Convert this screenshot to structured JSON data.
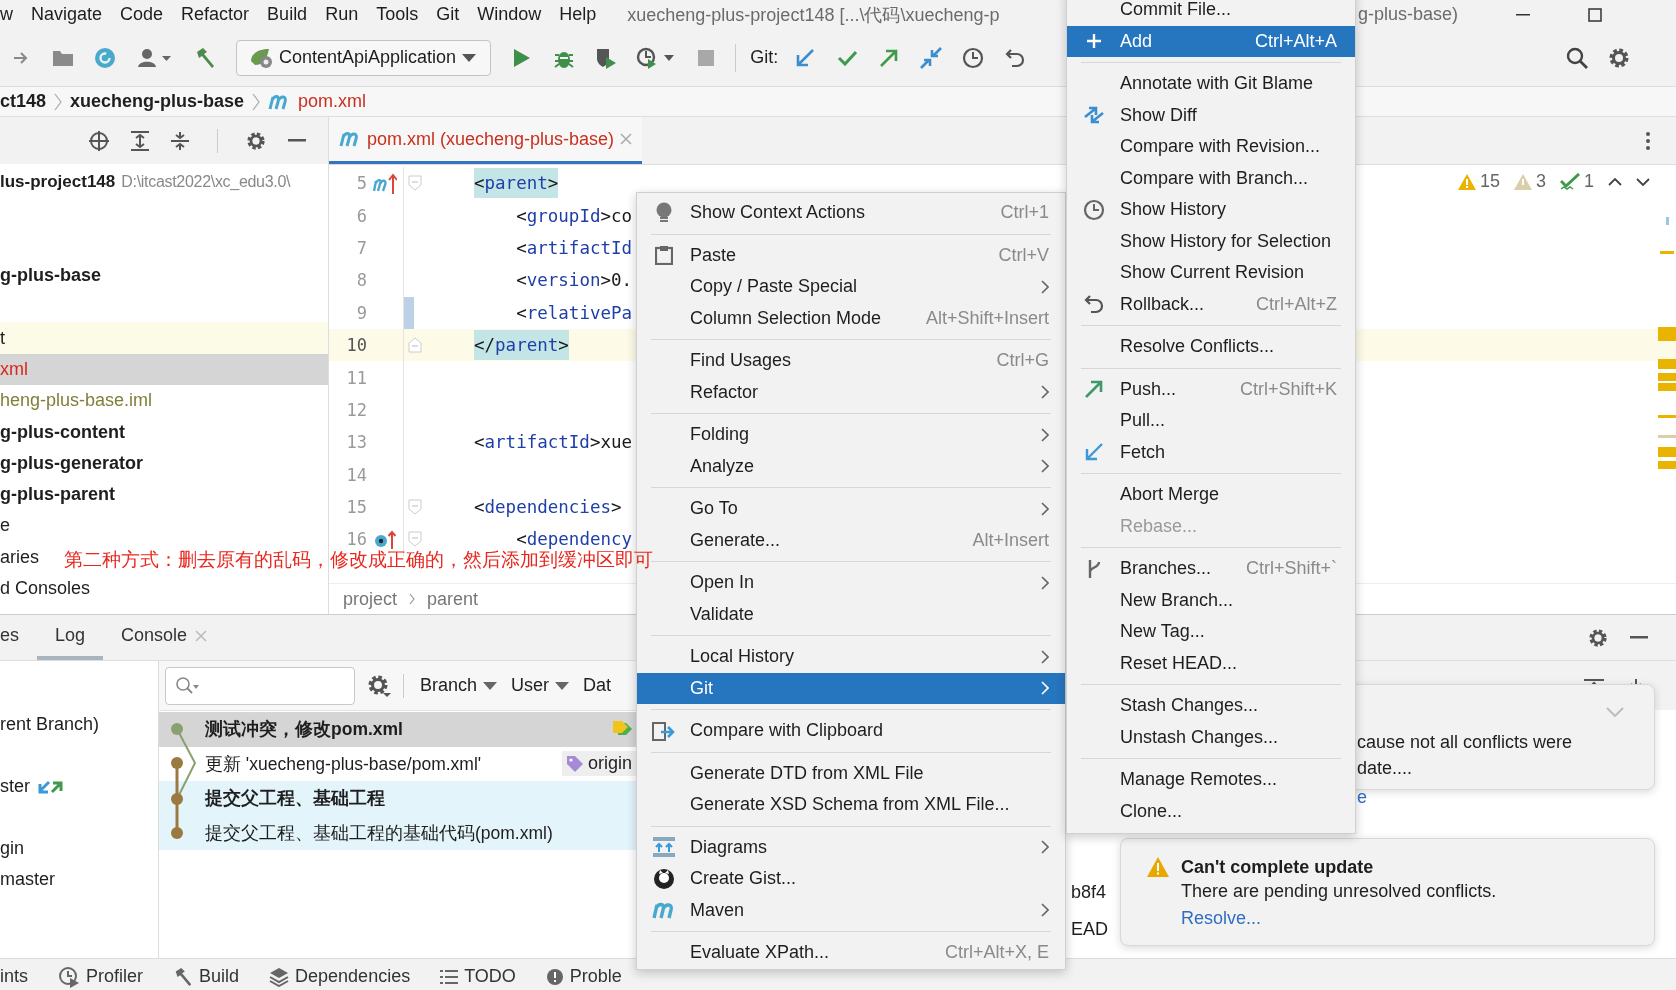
{
  "menu_bar": {
    "items": [
      "w",
      "Navigate",
      "Code",
      "Refactor",
      "Build",
      "Run",
      "Tools",
      "Git",
      "Window",
      "Help"
    ],
    "title": "xuecheng-plus-project148 [...\\代码\\xuecheng-p",
    "title_rest": "g-plus-base)"
  },
  "toolbar": {
    "run_config": "ContentApiApplication",
    "git_label": "Git:"
  },
  "breadcrumb": [
    {
      "text": "ct148",
      "kind": "folder"
    },
    {
      "text": "xuecheng-plus-base",
      "kind": "folder"
    },
    {
      "text": "pom.xml",
      "kind": "maven"
    }
  ],
  "project": {
    "root": {
      "name": "lus-project148",
      "path": "D:\\itcast2022\\xc_edu3.0\\"
    },
    "items": [
      {
        "kind": "blank",
        "selected": false,
        "highlighted": false
      },
      {
        "kind": "blank",
        "selected": false,
        "highlighted": false
      },
      {
        "text": "g-plus-base",
        "kind": "module",
        "selected": false,
        "highlighted": false,
        "color": "#1e1e1e"
      },
      {
        "kind": "blank",
        "selected": false,
        "highlighted": false
      },
      {
        "text": "t",
        "kind": "file",
        "selected": false,
        "highlighted": true,
        "color": "#1e1e1e"
      },
      {
        "text": "xml",
        "kind": "file",
        "selected": true,
        "highlighted": false,
        "color": "#d8281e"
      },
      {
        "text": "heng-plus-base.iml",
        "kind": "file",
        "selected": false,
        "highlighted": false,
        "color": "#7f7f3a"
      },
      {
        "text": "g-plus-content",
        "kind": "module",
        "selected": false,
        "highlighted": false,
        "color": "#1e1e1e"
      },
      {
        "text": "g-plus-generator",
        "kind": "module",
        "selected": false,
        "highlighted": false,
        "color": "#1e1e1e"
      },
      {
        "text": "g-plus-parent",
        "kind": "module",
        "selected": false,
        "highlighted": false,
        "color": "#1e1e1e"
      },
      {
        "text": "e",
        "kind": "file",
        "selected": false,
        "highlighted": false,
        "color": "#1e1e1e"
      },
      {
        "text": "aries",
        "kind": "file",
        "selected": false,
        "highlighted": false,
        "color": "#1e1e1e"
      },
      {
        "text": "d Consoles",
        "kind": "file",
        "selected": false,
        "highlighted": false,
        "color": "#1e1e1e"
      }
    ]
  },
  "editor": {
    "tab": {
      "label": "pom.xml (xuecheng-plus-base)",
      "selected": true
    },
    "lines": [
      {
        "number": "5",
        "code": "<parent>",
        "kind": "maven-marker",
        "matched": true,
        "current": false,
        "changed": false,
        "fold_start": true,
        "fold_end": false
      },
      {
        "number": "6",
        "code": "    <groupId>co",
        "kind": "plain",
        "matched": false,
        "current": false,
        "changed": false,
        "fold_start": false,
        "fold_end": false
      },
      {
        "number": "7",
        "code": "    <artifactId",
        "kind": "plain",
        "matched": false,
        "current": false,
        "changed": false,
        "fold_start": false,
        "fold_end": false
      },
      {
        "number": "8",
        "code": "    <version>0.",
        "kind": "plain",
        "matched": false,
        "current": false,
        "changed": false,
        "fold_start": false,
        "fold_end": false
      },
      {
        "number": "9",
        "code": "    <relativePa",
        "kind": "plain",
        "matched": false,
        "current": false,
        "changed": true,
        "fold_start": false,
        "fold_end": false
      },
      {
        "number": "10",
        "code": "</parent>",
        "kind": "plain",
        "matched": true,
        "current": true,
        "changed": false,
        "fold_start": false,
        "fold_end": true
      },
      {
        "number": "11",
        "kind": "plain",
        "current": false,
        "changed": false,
        "fold_start": false,
        "fold_end": false
      },
      {
        "number": "12",
        "kind": "plain",
        "current": false,
        "changed": false,
        "fold_start": false,
        "fold_end": false
      },
      {
        "number": "13",
        "code": "<artifactId>xue",
        "kind": "plain",
        "matched": false,
        "current": false,
        "changed": false,
        "fold_start": false,
        "fold_end": false
      },
      {
        "number": "14",
        "kind": "plain",
        "current": false,
        "changed": false,
        "fold_start": false,
        "fold_end": false
      },
      {
        "number": "15",
        "code": "<dependencies>",
        "kind": "plain",
        "matched": false,
        "current": false,
        "changed": false,
        "fold_start": true,
        "fold_end": false
      },
      {
        "number": "16",
        "code": "    <dependency",
        "kind": "dependency-marker",
        "matched": false,
        "current": false,
        "changed": false,
        "fold_start": true,
        "fold_end": false
      }
    ],
    "inspections": {
      "warnings": "15",
      "weak_warnings": "3",
      "typos": "1"
    },
    "breadcrumb": [
      "project",
      "parent"
    ]
  },
  "context_menu": {
    "sections": [
      {
        "items": [
          {
            "label": "Show Context Actions",
            "shortcut": "Ctrl+1",
            "submenu": false,
            "selected": false
          }
        ]
      },
      {
        "items": [
          {
            "label": "Paste",
            "shortcut": "Ctrl+V",
            "submenu": false,
            "selected": false
          },
          {
            "label": "Copy / Paste Special",
            "submenu": true,
            "selected": false
          },
          {
            "label": "Column Selection Mode",
            "shortcut": "Alt+Shift+Insert",
            "submenu": false,
            "selected": false
          }
        ]
      },
      {
        "items": [
          {
            "label": "Find Usages",
            "shortcut": "Ctrl+G",
            "submenu": false,
            "selected": false
          },
          {
            "label": "Refactor",
            "submenu": true,
            "selected": false
          }
        ]
      },
      {
        "items": [
          {
            "label": "Folding",
            "submenu": true,
            "selected": false
          },
          {
            "label": "Analyze",
            "submenu": true,
            "selected": false
          }
        ]
      },
      {
        "items": [
          {
            "label": "Go To",
            "submenu": true,
            "selected": false
          },
          {
            "label": "Generate...",
            "shortcut": "Alt+Insert",
            "submenu": false,
            "selected": false
          }
        ]
      },
      {
        "items": [
          {
            "label": "Open In",
            "submenu": true,
            "selected": false
          },
          {
            "label": "Validate",
            "submenu": false,
            "selected": false
          }
        ]
      },
      {
        "items": [
          {
            "label": "Local History",
            "submenu": true,
            "selected": false
          },
          {
            "label": "Git",
            "submenu": true,
            "selected": true
          }
        ]
      },
      {
        "items": [
          {
            "label": "Compare with Clipboard",
            "submenu": false,
            "selected": false
          }
        ]
      },
      {
        "items": [
          {
            "label": "Generate DTD from XML File",
            "submenu": false,
            "selected": false
          },
          {
            "label": "Generate XSD Schema from XML File...",
            "submenu": false,
            "selected": false
          }
        ]
      },
      {
        "items": [
          {
            "label": "Diagrams",
            "submenu": true,
            "selected": false
          },
          {
            "label": "Create Gist...",
            "submenu": false,
            "selected": false
          },
          {
            "label": "Maven",
            "submenu": true,
            "selected": false
          }
        ]
      },
      {
        "items": [
          {
            "label": "Evaluate XPath...",
            "shortcut": "Ctrl+Alt+X, E",
            "submenu": false,
            "selected": false
          }
        ]
      }
    ]
  },
  "git_menu": {
    "sections": [
      {
        "items": [
          {
            "label": "Commit File...",
            "selected": false,
            "disabled": false
          },
          {
            "label": "Add",
            "shortcut": "Ctrl+Alt+A",
            "selected": true,
            "disabled": false
          }
        ]
      },
      {
        "items": [
          {
            "label": "Annotate with Git Blame",
            "selected": false,
            "disabled": false
          },
          {
            "label": "Show Diff",
            "selected": false,
            "disabled": false
          },
          {
            "label": "Compare with Revision...",
            "selected": false,
            "disabled": false
          },
          {
            "label": "Compare with Branch...",
            "selected": false,
            "disabled": false
          },
          {
            "label": "Show History",
            "selected": false,
            "disabled": false
          },
          {
            "label": "Show History for Selection",
            "selected": false,
            "disabled": false
          },
          {
            "label": "Show Current Revision",
            "selected": false,
            "disabled": false
          },
          {
            "label": "Rollback...",
            "shortcut": "Ctrl+Alt+Z",
            "selected": false,
            "disabled": false
          }
        ]
      },
      {
        "items": [
          {
            "label": "Resolve Conflicts...",
            "selected": false,
            "disabled": false
          }
        ]
      },
      {
        "items": [
          {
            "label": "Push...",
            "shortcut": "Ctrl+Shift+K",
            "selected": false,
            "disabled": false
          },
          {
            "label": "Pull...",
            "selected": false,
            "disabled": false
          },
          {
            "label": "Fetch",
            "selected": false,
            "disabled": false
          }
        ]
      },
      {
        "items": [
          {
            "label": "Abort Merge",
            "selected": false,
            "disabled": false
          },
          {
            "label": "Rebase...",
            "selected": false,
            "disabled": true
          }
        ]
      },
      {
        "items": [
          {
            "label": "Branches...",
            "shortcut": "Ctrl+Shift+`",
            "selected": false,
            "disabled": false
          },
          {
            "label": "New Branch...",
            "selected": false,
            "disabled": false
          },
          {
            "label": "New Tag...",
            "selected": false,
            "disabled": false
          },
          {
            "label": "Reset HEAD...",
            "selected": false,
            "disabled": false
          }
        ]
      },
      {
        "items": [
          {
            "label": "Stash Changes...",
            "selected": false,
            "disabled": false
          },
          {
            "label": "Unstash Changes...",
            "selected": false,
            "disabled": false
          }
        ]
      },
      {
        "items": [
          {
            "label": "Manage Remotes...",
            "selected": false,
            "disabled": false
          },
          {
            "label": "Clone...",
            "selected": false,
            "disabled": false
          }
        ]
      }
    ]
  },
  "log": {
    "tabs": [
      {
        "label": "es",
        "selected": false,
        "closable": false
      },
      {
        "label": "Log",
        "selected": true,
        "closable": false
      },
      {
        "label": "Console",
        "selected": false,
        "closable": true
      }
    ],
    "branches": [
      {
        "text": "rent Branch)",
        "kind": "plain"
      },
      {
        "kind": "blank"
      },
      {
        "text": "ster",
        "kind": "tracked"
      },
      {
        "kind": "blank"
      },
      {
        "text": "gin",
        "kind": "plain"
      },
      {
        "text": "master",
        "kind": "plain"
      }
    ],
    "filters": [
      {
        "label": "Branch",
        "dropdown": true
      },
      {
        "label": "User",
        "dropdown": true
      },
      {
        "label": "Dat",
        "dropdown": false
      }
    ],
    "commits": [
      {
        "subject": "测试冲突，修改pom.xml",
        "bold": true,
        "selected": true,
        "highlighted": false,
        "ref": {
          "kind": "multi"
        }
      },
      {
        "subject": "更新 'xuecheng-plus-base/pom.xml'",
        "bold": false,
        "selected": false,
        "highlighted": false,
        "ref": {
          "kind": "remote",
          "text": "origin"
        }
      },
      {
        "subject": "提交父工程、基础工程",
        "bold": true,
        "selected": false,
        "highlighted": true
      },
      {
        "subject": "提交父工程、基础工程的基础代码(pom.xml)",
        "bold": false,
        "selected": false,
        "highlighted": true
      }
    ],
    "details": [
      "b8f4",
      "EAD"
    ]
  },
  "notifications": [
    {
      "kind": "partial",
      "lines": [
        "cause not all conflicts were",
        "date...."
      ],
      "link": "e"
    },
    {
      "kind": "warning",
      "title": "Can't complete update",
      "body": "There are pending unresolved conflicts.",
      "link": "Resolve..."
    }
  ],
  "bottom_strip": [
    "ints",
    "Profiler",
    "Build",
    "Dependencies",
    "TODO",
    "Proble"
  ],
  "annotation": "第二种方式：删去原有的乱码，修改成正确的，然后添加到缓冲区即可"
}
